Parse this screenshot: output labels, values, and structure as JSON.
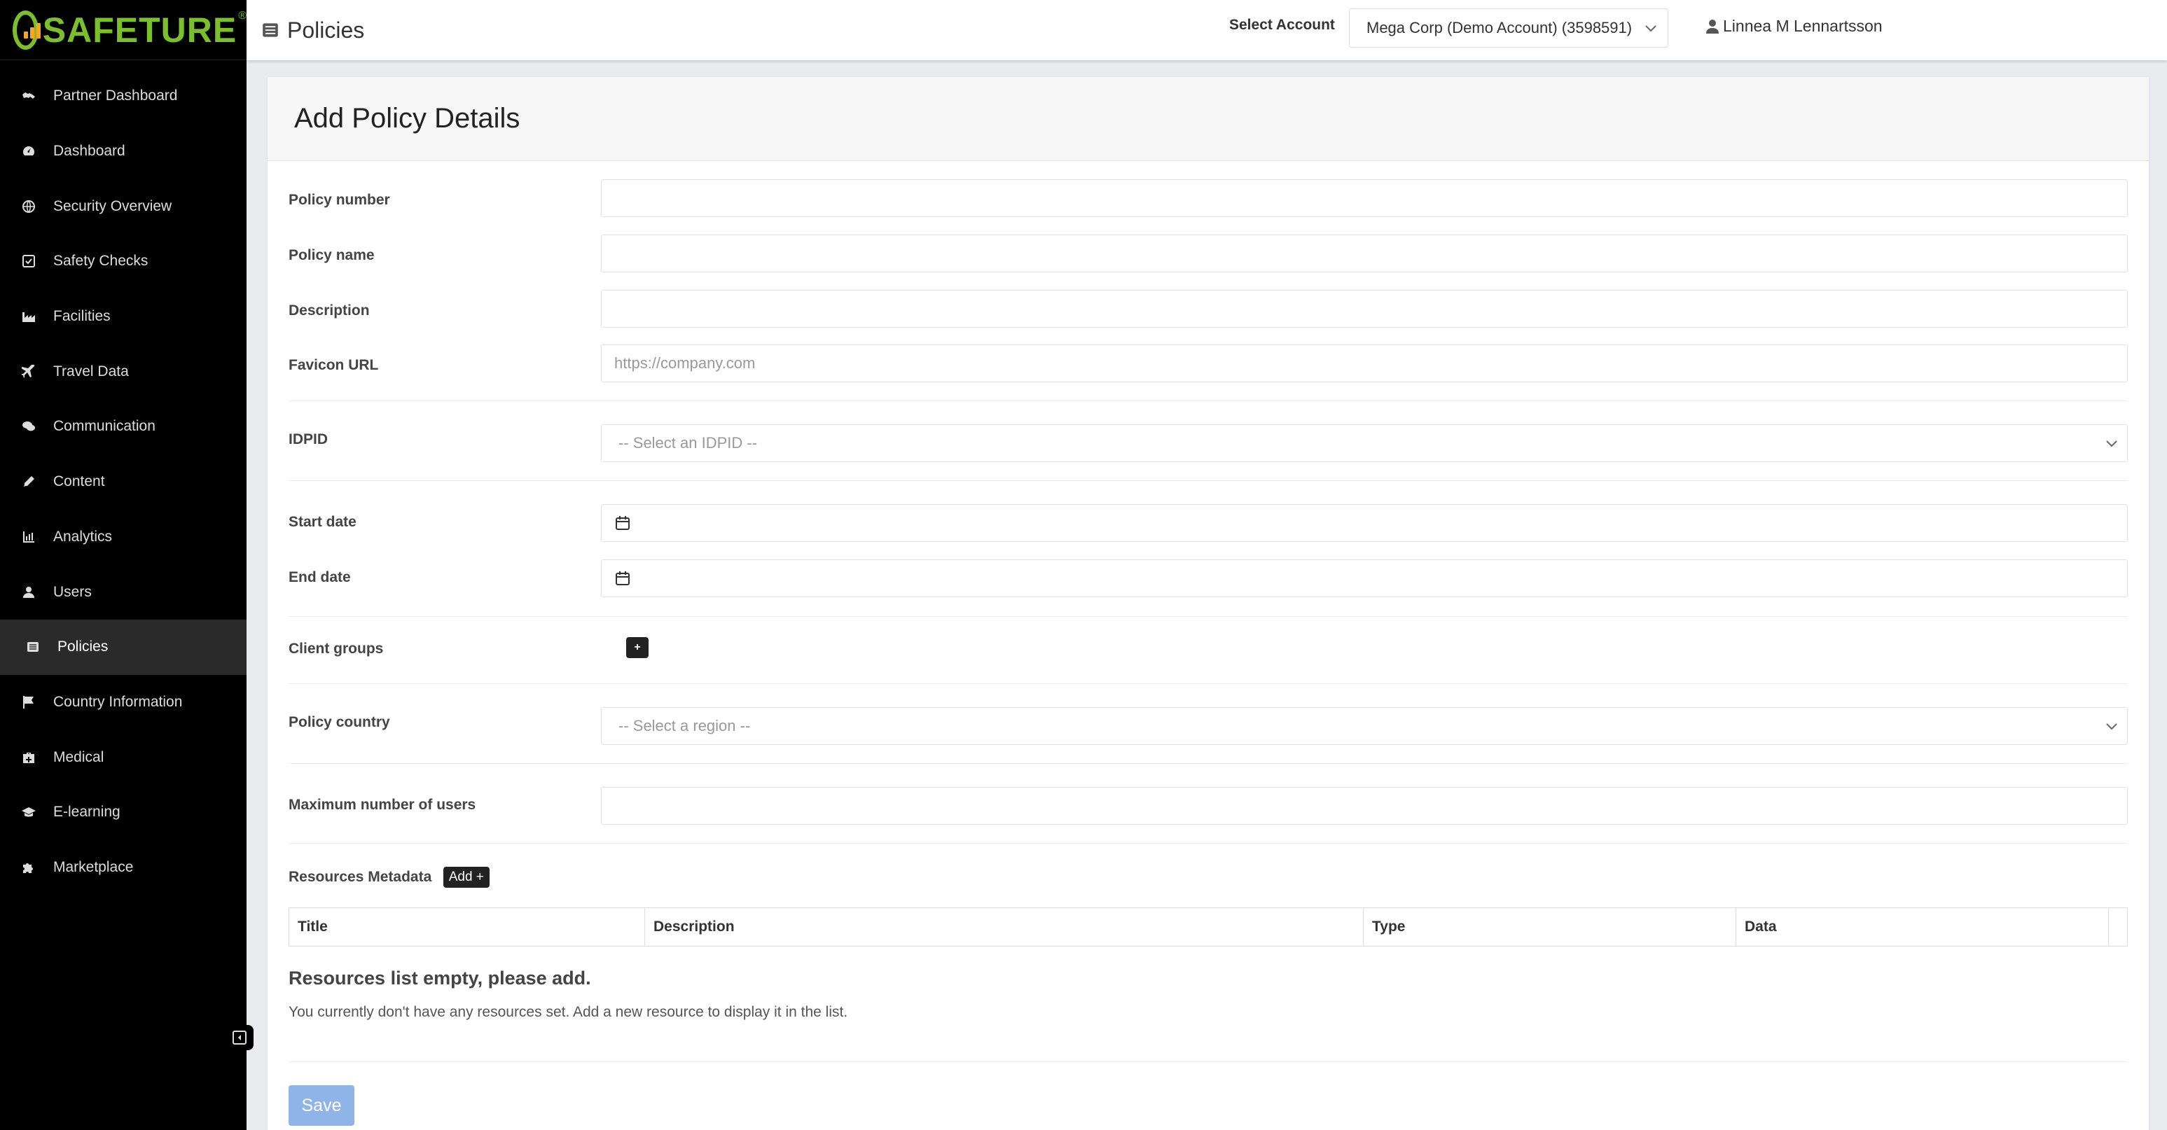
{
  "brand": {
    "name": "SAFETURE",
    "registered": "®",
    "primary_color": "#7bbf2a",
    "accent_color": "#f5a623"
  },
  "sidebar": {
    "items": [
      {
        "label": "Partner Dashboard",
        "icon": "handshake-icon"
      },
      {
        "label": "Dashboard",
        "icon": "gauge-icon"
      },
      {
        "label": "Security Overview",
        "icon": "globe-icon"
      },
      {
        "label": "Safety Checks",
        "icon": "checkbox-icon"
      },
      {
        "label": "Facilities",
        "icon": "industry-icon"
      },
      {
        "label": "Travel Data",
        "icon": "plane-icon"
      },
      {
        "label": "Communication",
        "icon": "chat-icon"
      },
      {
        "label": "Content",
        "icon": "pencil-icon"
      },
      {
        "label": "Analytics",
        "icon": "chart-icon"
      },
      {
        "label": "Users",
        "icon": "user-icon"
      },
      {
        "label": "Policies",
        "icon": "list-icon",
        "active": true
      },
      {
        "label": "Country Information",
        "icon": "flag-icon"
      },
      {
        "label": "Medical",
        "icon": "medkit-icon"
      },
      {
        "label": "E-learning",
        "icon": "graduation-cap-icon"
      },
      {
        "label": "Marketplace",
        "icon": "puzzle-icon"
      }
    ]
  },
  "header": {
    "title": "Policies",
    "account_label": "Select Account",
    "account_value": "Mega Corp (Demo Account) (3598591)",
    "user_name": "Linnea M Lennartsson"
  },
  "form": {
    "title": "Add Policy Details",
    "policy_number": {
      "label": "Policy number",
      "value": ""
    },
    "policy_name": {
      "label": "Policy name",
      "value": ""
    },
    "description": {
      "label": "Description",
      "value": ""
    },
    "favicon_url": {
      "label": "Favicon URL",
      "placeholder": "https://company.com"
    },
    "idpid": {
      "label": "IDPID",
      "placeholder": "-- Select an IDPID --"
    },
    "start_date": {
      "label": "Start date",
      "value": ""
    },
    "end_date": {
      "label": "End date",
      "value": ""
    },
    "client_groups": {
      "label": "Client groups",
      "add_label": "+"
    },
    "policy_country": {
      "label": "Policy country",
      "placeholder": "-- Select a region --"
    },
    "max_users": {
      "label": "Maximum number of users",
      "value": ""
    },
    "resources": {
      "label": "Resources Metadata",
      "add_label": "Add +",
      "columns": [
        "Title",
        "Description",
        "Type",
        "Data"
      ],
      "empty_title": "Resources list empty, please add.",
      "empty_text": "You currently don't have any resources set. Add a new resource to display it in the list."
    },
    "save_label": "Save"
  }
}
